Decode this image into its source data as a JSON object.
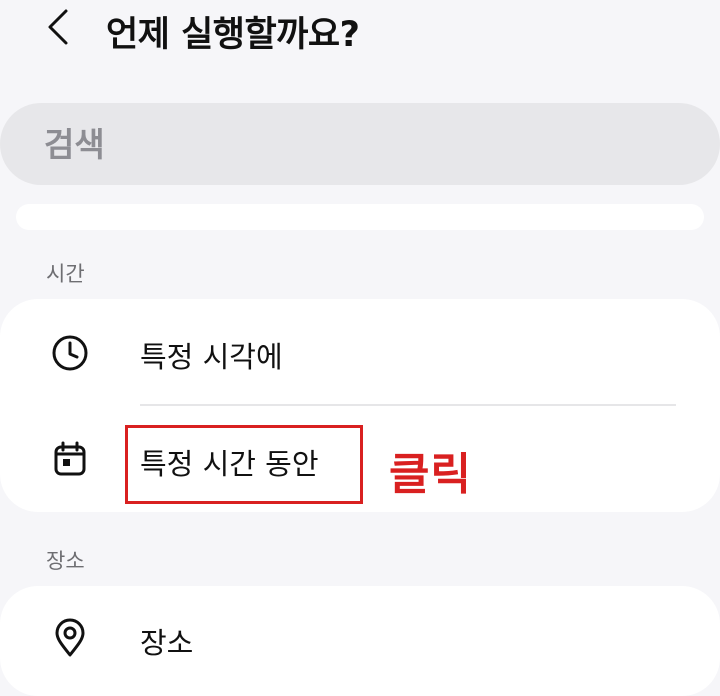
{
  "header": {
    "title": "언제 실행할까요?",
    "back_icon": "chevron-left-icon"
  },
  "search": {
    "placeholder": "검색"
  },
  "sections": {
    "time": {
      "title": "시간",
      "items": [
        {
          "label": "특정 시각에",
          "icon": "clock-icon"
        },
        {
          "label": "특정 시간 동안",
          "icon": "calendar-icon"
        }
      ]
    },
    "location": {
      "title": "장소",
      "items": [
        {
          "label": "장소",
          "icon": "location-pin-icon"
        }
      ]
    }
  },
  "annotation": {
    "text": "클릭",
    "color": "#d92020"
  },
  "colors": {
    "background": "#f6f6f9",
    "card": "#ffffff",
    "search_bg": "#e7e7ea",
    "accent_red": "#d92020"
  }
}
